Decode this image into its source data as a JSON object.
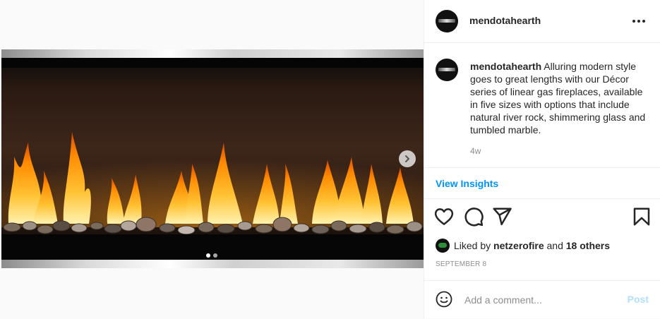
{
  "post": {
    "username": "mendotahearth",
    "caption": "Alluring modern style goes to great lengths with our Décor series of linear gas fireplaces, available in five sizes with options that include natural river rock, shimmering glass and tumbled marble.",
    "time_ago": "4w",
    "insights_label": "View Insights",
    "liked_by_prefix": "Liked by",
    "liked_by_user": "netzerofire",
    "liked_by_conj": "and",
    "liked_by_others": "18 others",
    "date": "SEPTEMBER 8",
    "carousel": {
      "total_slides": 2,
      "current_slide": 1
    }
  },
  "comment": {
    "placeholder": "Add a comment...",
    "post_label": "Post"
  },
  "icons": {
    "more": "more-options-icon",
    "like": "heart-icon",
    "comment": "comment-icon",
    "share": "paper-plane-icon",
    "save": "bookmark-icon",
    "emoji": "smiley-icon",
    "next": "chevron-right-icon"
  },
  "colors": {
    "link_blue": "#0095f6",
    "post_disabled": "#b2dffc",
    "muted": "#8e8e8e",
    "text": "#262626"
  }
}
